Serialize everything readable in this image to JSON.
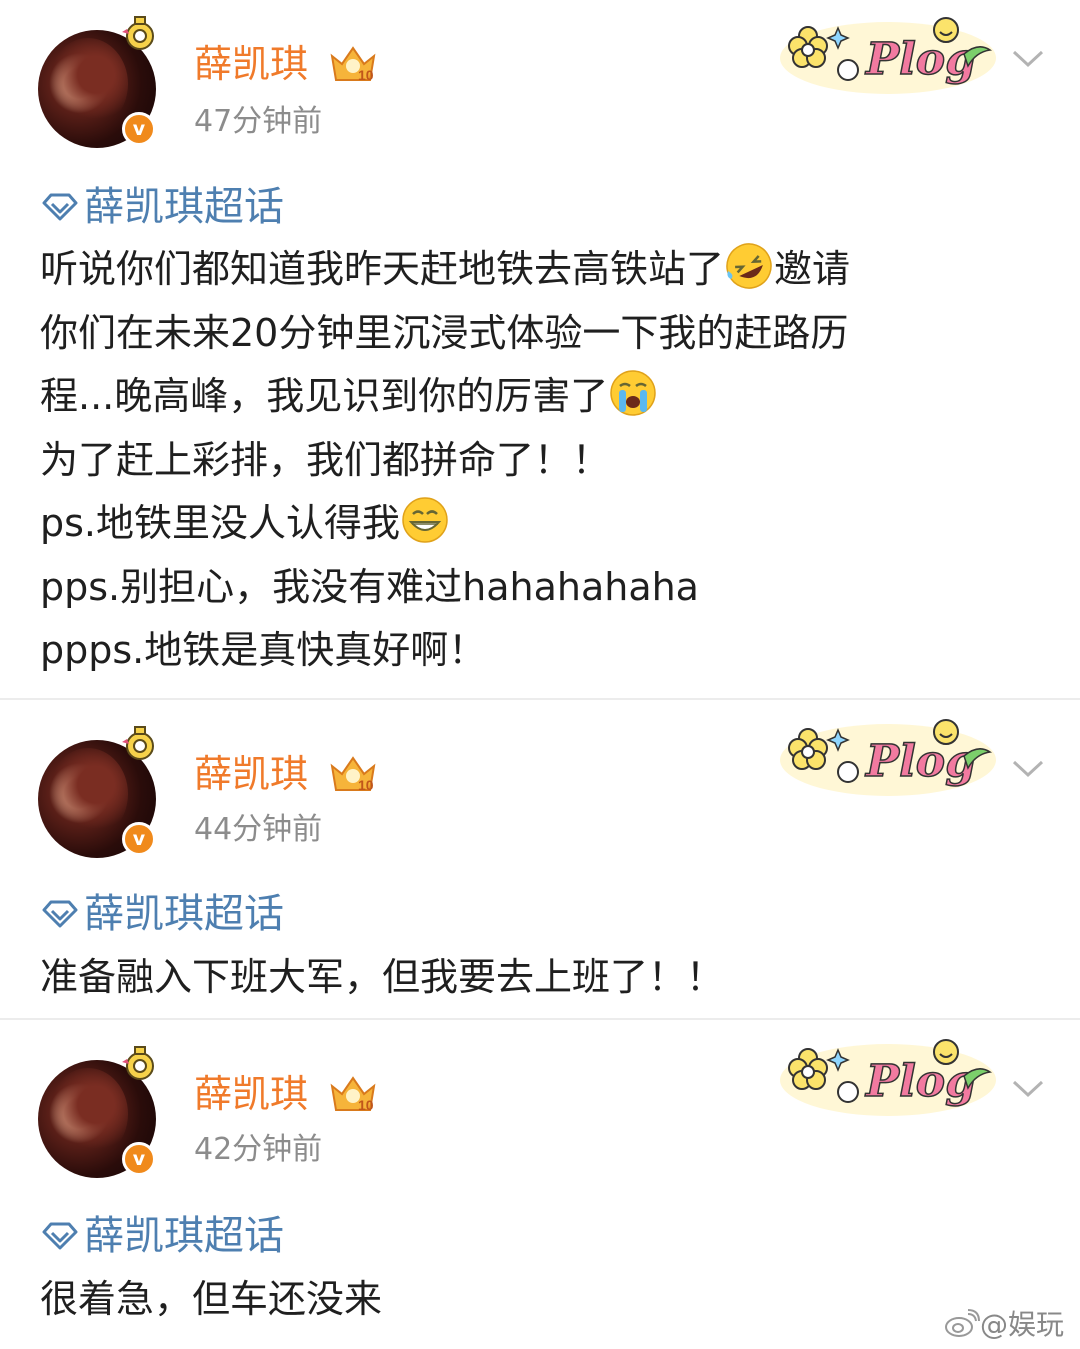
{
  "posts": [
    {
      "author": "薛凯琪",
      "time": "47分钟前",
      "topic": "薛凯琪超话",
      "lines": [
        "听说你们都知道我昨天赶地铁去高铁站了",
        "邀请",
        "你们在未来20分钟里沉浸式体验一下我的赶路历",
        "程...晚高峰，我见识到你的厉害了",
        "为了赶上彩排，我们都拼命了！！",
        "ps.地铁里没人认得我",
        "pps.别担心，我没有难过hahahahaha",
        "ppps.地铁是真快真好啊！"
      ],
      "emojis": [
        "rofl-emoji",
        "crying-emoji",
        "grin-emoji"
      ]
    },
    {
      "author": "薛凯琪",
      "time": "44分钟前",
      "topic": "薛凯琪超话",
      "lines": [
        "准备融入下班大军，但我要去上班了！！"
      ]
    },
    {
      "author": "薛凯琪",
      "time": "42分钟前",
      "topic": "薛凯琪超话",
      "lines": [
        "很着急，但车还没来"
      ]
    }
  ],
  "badge": {
    "vip_level": "10",
    "verified_mark": "v"
  },
  "sticker": {
    "text": "Plog"
  },
  "watermark": {
    "text": "@娱玩"
  },
  "colors": {
    "name": "#f07a2a",
    "topic": "#4e7fb0",
    "time": "#8c8c8c",
    "verified": "#f08a1c"
  },
  "icons": [
    "avatar",
    "verified-icon",
    "crown-badge-icon",
    "plog-sticker",
    "chevron-down-icon",
    "supertopic-diamond-icon",
    "weibo-logo-icon"
  ]
}
